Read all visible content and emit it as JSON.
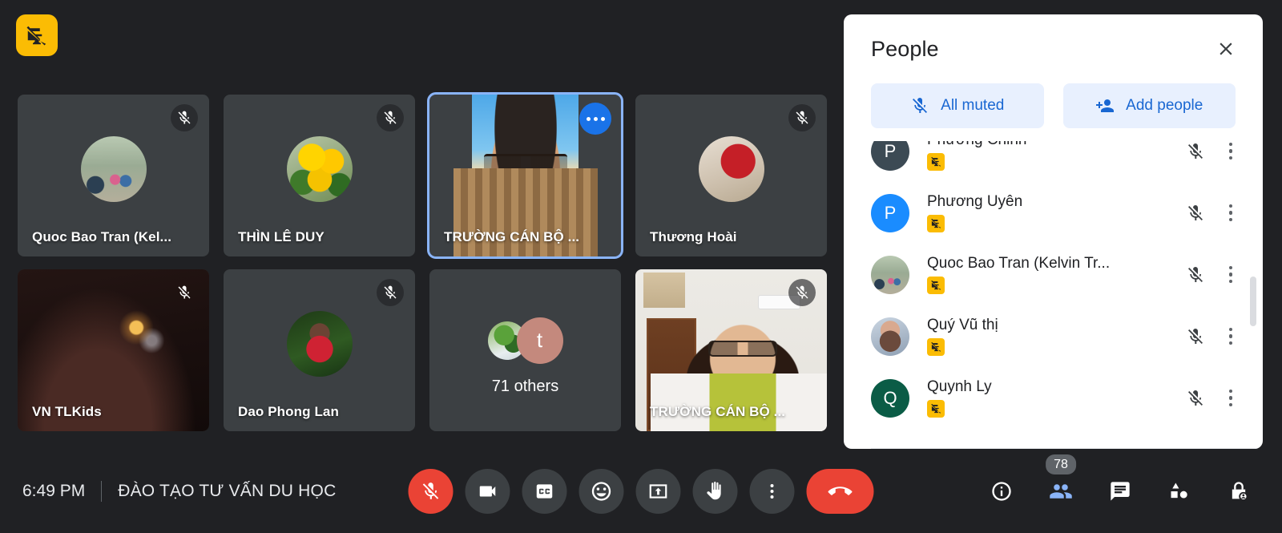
{
  "meeting": {
    "time": "6:49 PM",
    "title": "ĐÀO TẠO TƯ VẤN DU HỌC",
    "participant_count": "78",
    "presentation_badge_icon": "presentation-off-icon"
  },
  "tiles": [
    {
      "name": "Quoc Bao Tran (Kel...",
      "muted": true,
      "active": false,
      "kind": "avatar",
      "art": "img-family",
      "initial": ""
    },
    {
      "name": "THÌN LÊ DUY",
      "muted": true,
      "active": false,
      "kind": "avatar",
      "art": "img-yellowflower",
      "initial": ""
    },
    {
      "name": "TRƯỜNG CÁN BỘ ...",
      "muted": false,
      "active": true,
      "kind": "video-beach",
      "art": "",
      "initial": ""
    },
    {
      "name": "Thương Hoài",
      "muted": true,
      "active": false,
      "kind": "avatar",
      "art": "img-redbook",
      "initial": ""
    },
    {
      "name": "VN TLKids",
      "muted": true,
      "active": false,
      "kind": "video-dark",
      "art": "img-darkcar",
      "initial": ""
    },
    {
      "name": "Dao Phong Lan",
      "muted": true,
      "active": false,
      "kind": "avatar",
      "art": "img-lady",
      "initial": ""
    },
    {
      "name": "71 others",
      "muted": false,
      "active": false,
      "kind": "others",
      "art": "img-moss",
      "initial": "t"
    },
    {
      "name": "TRƯỜNG CÁN BỘ ...",
      "muted": true,
      "active": false,
      "kind": "video-room",
      "art": "",
      "initial": ""
    }
  ],
  "controls": {
    "mic_label": "mic-off-icon",
    "camera_label": "camera-icon",
    "captions_label": "closed-captions-icon",
    "reactions_label": "emoji-icon",
    "present_label": "present-screen-icon",
    "raise_hand_label": "raise-hand-icon",
    "more_label": "more-options-icon",
    "hangup_label": "end-call-icon"
  },
  "right_controls": {
    "info_label": "meeting-details-icon",
    "people_label": "people-icon",
    "chat_label": "chat-icon",
    "activities_label": "activities-icon",
    "host_controls_label": "host-controls-icon"
  },
  "panel": {
    "title": "People",
    "close_label": "close-icon",
    "all_muted_label": "All muted",
    "add_people_label": "Add people",
    "people": [
      {
        "name": "Phương Chinh",
        "initial": "P",
        "avatar_color": "#3c4a54",
        "has_photo": false,
        "photo_art": "",
        "muted": true,
        "partial": true
      },
      {
        "name": "Phương Uyên",
        "initial": "P",
        "avatar_color": "#1a8cff",
        "has_photo": false,
        "photo_art": "",
        "muted": true,
        "partial": false
      },
      {
        "name": "Quoc Bao Tran (Kelvin Tr...",
        "initial": "",
        "avatar_color": "#8aa38a",
        "has_photo": true,
        "photo_art": "img-family",
        "muted": true,
        "partial": false
      },
      {
        "name": "Quý Vũ thị",
        "initial": "",
        "avatar_color": "#b7a9a3",
        "has_photo": true,
        "photo_art": "img-portrait",
        "muted": true,
        "partial": false
      },
      {
        "name": "Quynh Ly",
        "initial": "Q",
        "avatar_color": "#0b5c46",
        "has_photo": false,
        "photo_art": "",
        "muted": true,
        "partial": false
      }
    ]
  },
  "colors": {
    "app_bg": "#202124",
    "tile_bg": "#3c4043",
    "accent_blue": "#1a73e8",
    "light_blue": "#8ab4f8",
    "chip_bg": "#e8f0fe",
    "chip_text": "#1967d2",
    "danger_red": "#ea4335",
    "badge_yellow": "#fbbc04"
  }
}
